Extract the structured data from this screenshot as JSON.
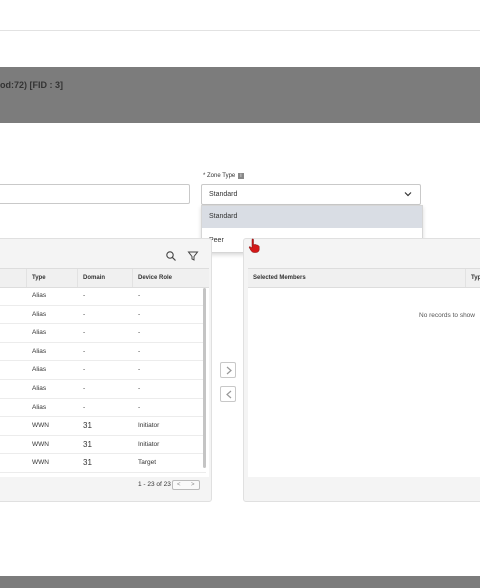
{
  "header": {
    "title": "od:72) [FID : 3]"
  },
  "zone_type": {
    "label": "* Zone Type",
    "info_glyph": "i",
    "selected": "Standard",
    "options": [
      "Standard",
      "Peer"
    ]
  },
  "left_table": {
    "columns": [
      "Type",
      "Domain",
      "Device Role"
    ],
    "rows": [
      {
        "type": "Alias",
        "domain": "-",
        "role": "-"
      },
      {
        "type": "Alias",
        "domain": "-",
        "role": "-"
      },
      {
        "type": "Alias",
        "domain": "-",
        "role": "-"
      },
      {
        "type": "Alias",
        "domain": "-",
        "role": "-"
      },
      {
        "type": "Alias",
        "domain": "-",
        "role": "-"
      },
      {
        "type": "Alias",
        "domain": "-",
        "role": "-"
      },
      {
        "type": "Alias",
        "domain": "-",
        "role": "-"
      },
      {
        "type": "WWN",
        "domain": "31",
        "role": "Initiator"
      },
      {
        "type": "WWN",
        "domain": "31",
        "role": "Initiator"
      },
      {
        "type": "WWN",
        "domain": "31",
        "role": "Target"
      }
    ],
    "pager": "1 - 23 of 23"
  },
  "right_table": {
    "columns": [
      "Selected Members",
      "Typ"
    ],
    "empty_text": "No records to show"
  },
  "icons": [
    "search-icon",
    "filter-icon",
    "chevron-down-icon",
    "arrow-right-icon",
    "arrow-left-icon",
    "hand-cursor-icon"
  ]
}
